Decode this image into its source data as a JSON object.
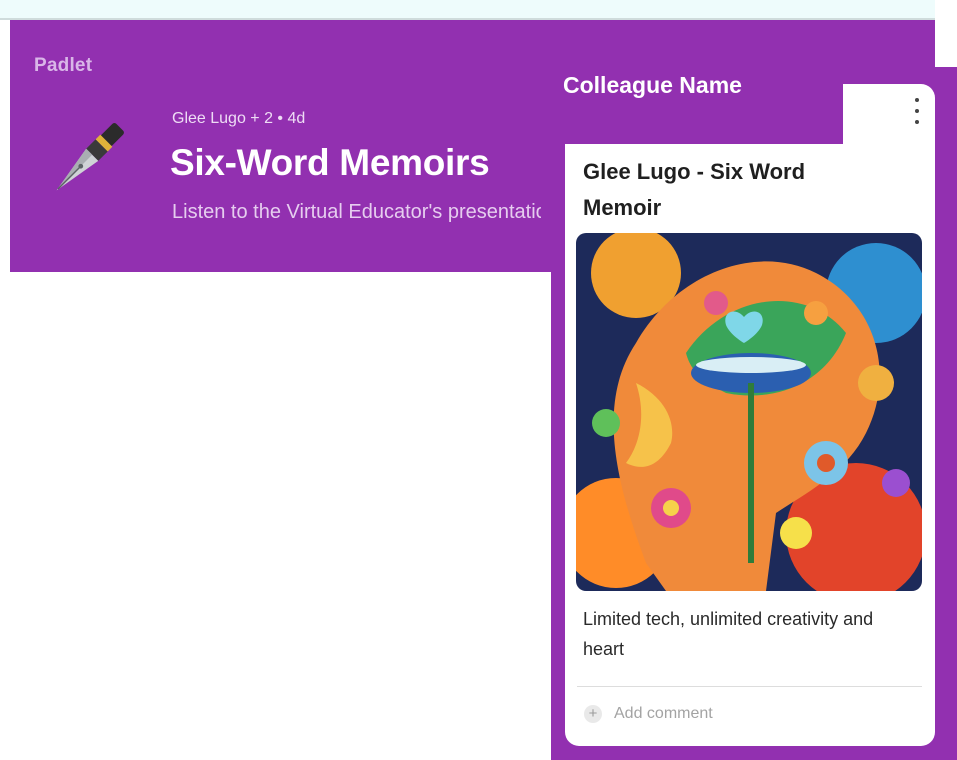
{
  "app": {
    "brand": "Padlet"
  },
  "board": {
    "meta": "Glee Lugo + 2 • 4d",
    "title": "Six-Word Memoirs",
    "subtitle": "Listen to the Virtual Educator's presentation"
  },
  "overlay": {
    "colleague_label": "Colleague Name"
  },
  "post": {
    "title": "Glee Lugo - Six Word Memoir",
    "image_icon": "colorful-face-artwork",
    "body": "Limited tech, unlimited creativity and heart",
    "add_comment": "Add comment"
  },
  "colors": {
    "banner": "#9230b0",
    "top_strip": "#eefcfc",
    "card": "#ffffff"
  }
}
